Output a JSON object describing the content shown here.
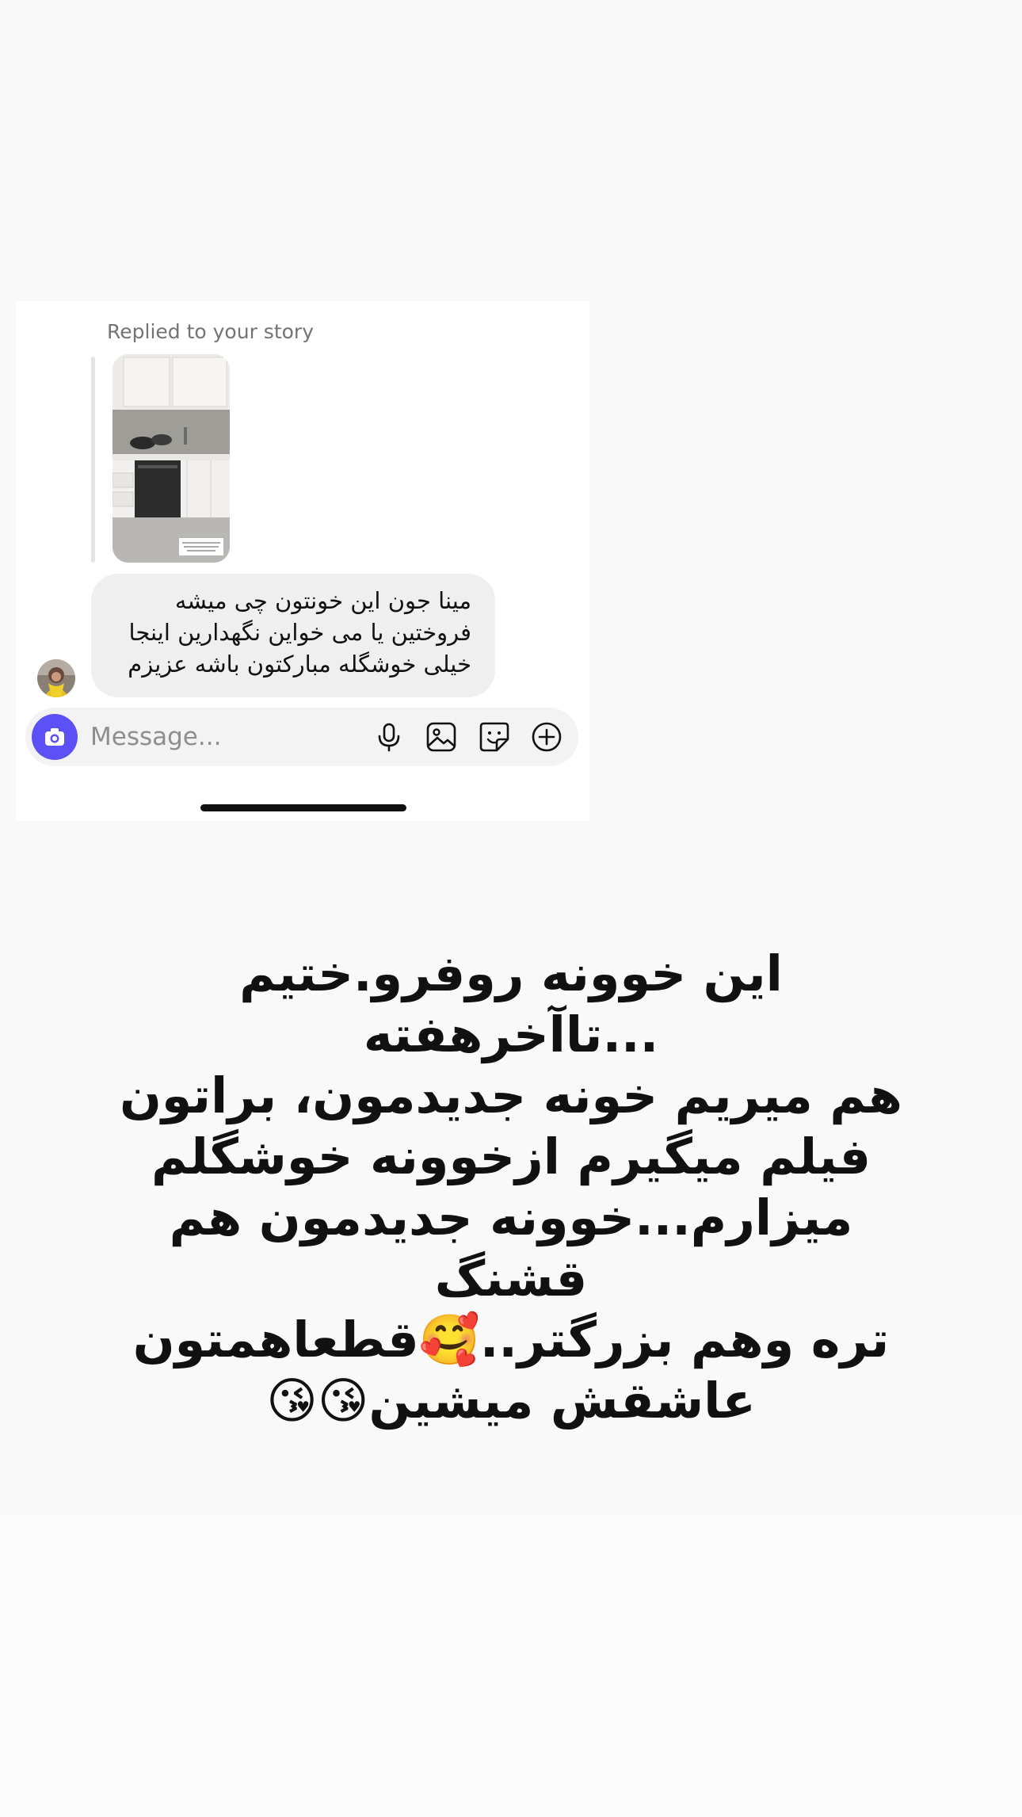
{
  "story_reply": {
    "label": "Replied to your story",
    "thumbnail_icon": "kitchen-story-thumbnail"
  },
  "message": {
    "text": "مینا جون این خونتون چی میشه فروختین یا می خواین نگهدارین اینجا خیلی خوشگله مبارکتون باشه عزیزم"
  },
  "composer": {
    "placeholder": "Message...",
    "icons": [
      "camera-icon",
      "microphone-icon",
      "gallery-icon",
      "sticker-icon",
      "add-icon"
    ],
    "accent": "#5b51f6"
  },
  "overlay": {
    "caption": "این خوونه روفرو.ختیم ...تاآخرهفته\nهم میریم خونه جدیدمون، براتون\nفیلم میگیرم ازخوونه خوشگلم\nمیزارم...خوونه جدیدمون هم قشنگ\nتره وهم بزرگتر..🥰قطعاهمتون\nعاشقش میشین😘😘"
  }
}
